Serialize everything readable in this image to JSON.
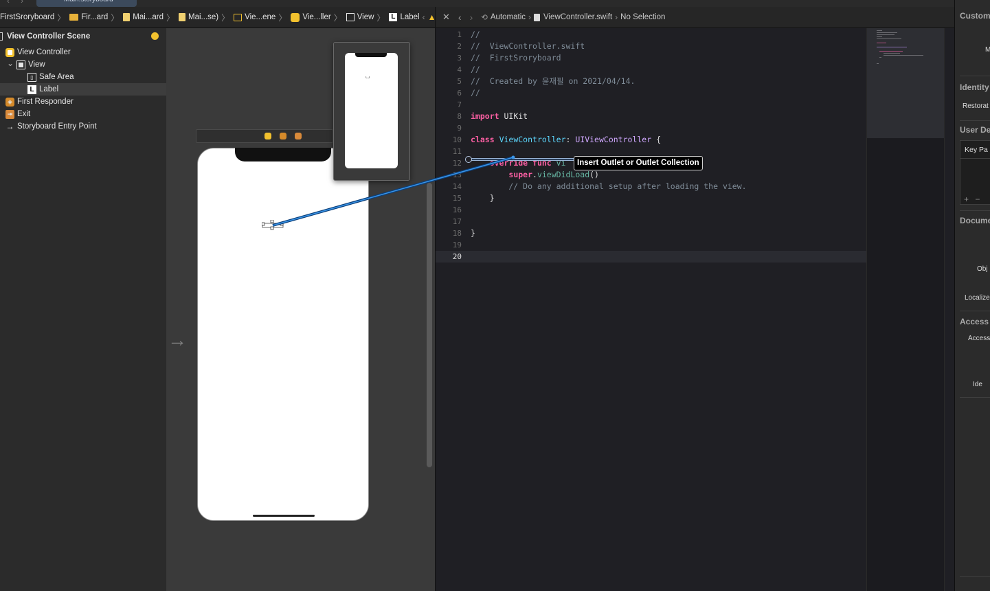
{
  "top": {
    "tab_title": "Main.storyboard"
  },
  "jumpbar_left": [
    {
      "label": "FirstSroryboard",
      "icon": "none"
    },
    {
      "label": "Fir...ard",
      "icon": "folder-icon"
    },
    {
      "label": "Mai...ard",
      "icon": "storyboard-file-icon"
    },
    {
      "label": "Mai...se)",
      "icon": "storyboard-file-icon"
    },
    {
      "label": "Vie...ene",
      "icon": "scene-icon"
    },
    {
      "label": "Vie...ller",
      "icon": "view-controller-icon"
    },
    {
      "label": "View",
      "icon": "view-icon"
    },
    {
      "label": "Label",
      "icon": "label-icon"
    }
  ],
  "jumpbar_right": {
    "mode": "Automatic",
    "file": "ViewController.swift",
    "selection": "No Selection"
  },
  "outline": {
    "scene": "View Controller Scene",
    "items": [
      {
        "label": "View Controller",
        "indent": 0,
        "icon": "view-controller-icon"
      },
      {
        "label": "View",
        "indent": 1,
        "icon": "view-icon",
        "disclosure": "v"
      },
      {
        "label": "Safe Area",
        "indent": 2,
        "icon": "safe-area-icon"
      },
      {
        "label": "Label",
        "indent": 2,
        "icon": "label-icon",
        "selected": true
      },
      {
        "label": "First Responder",
        "indent": 0,
        "icon": "first-responder-icon"
      },
      {
        "label": "Exit",
        "indent": 0,
        "icon": "exit-icon"
      },
      {
        "label": "Storyboard Entry Point",
        "indent": 0,
        "icon": "entry-point-icon"
      }
    ]
  },
  "canvas": {
    "label_text": "Label"
  },
  "code": {
    "lines": [
      {
        "n": "1",
        "tokens": [
          [
            "cm",
            "//"
          ]
        ]
      },
      {
        "n": "2",
        "tokens": [
          [
            "cm",
            "//  ViewController.swift"
          ]
        ]
      },
      {
        "n": "3",
        "tokens": [
          [
            "cm",
            "//  FirstSroryboard"
          ]
        ]
      },
      {
        "n": "4",
        "tokens": [
          [
            "cm",
            "//"
          ]
        ]
      },
      {
        "n": "5",
        "tokens": [
          [
            "cm",
            "//  Created by 윤재필 on 2021/04/14."
          ]
        ]
      },
      {
        "n": "6",
        "tokens": [
          [
            "cm",
            "//"
          ]
        ]
      },
      {
        "n": "7",
        "tokens": []
      },
      {
        "n": "8",
        "tokens": [
          [
            "kw",
            "import"
          ],
          [
            "pl",
            " UIKit"
          ]
        ]
      },
      {
        "n": "9",
        "tokens": []
      },
      {
        "n": "10",
        "tokens": [
          [
            "kw",
            "class"
          ],
          [
            "pl",
            " "
          ],
          [
            "nm",
            "ViewController"
          ],
          [
            "pl",
            ": "
          ],
          [
            "ty",
            "UIViewController"
          ],
          [
            "pl",
            " {"
          ]
        ]
      },
      {
        "n": "11",
        "tokens": []
      },
      {
        "n": "12",
        "tokens": [
          [
            "pl",
            "    "
          ],
          [
            "kw",
            "override"
          ],
          [
            "pl",
            " "
          ],
          [
            "kw",
            "func"
          ],
          [
            "pl",
            " "
          ],
          [
            "fn",
            "vi"
          ]
        ]
      },
      {
        "n": "13",
        "tokens": [
          [
            "pl",
            "        "
          ],
          [
            "kw",
            "super"
          ],
          [
            "pl",
            "."
          ],
          [
            "fn",
            "viewDidLoad"
          ],
          [
            "pl",
            "()"
          ]
        ]
      },
      {
        "n": "14",
        "tokens": [
          [
            "cm",
            "        // Do any additional setup after loading the view."
          ]
        ]
      },
      {
        "n": "15",
        "tokens": [
          [
            "pl",
            "    }"
          ]
        ]
      },
      {
        "n": "16",
        "tokens": []
      },
      {
        "n": "17",
        "tokens": []
      },
      {
        "n": "18",
        "tokens": [
          [
            "pl",
            "}"
          ]
        ]
      },
      {
        "n": "19",
        "tokens": []
      },
      {
        "n": "20",
        "tokens": [],
        "current": true
      }
    ],
    "tooltip": "Insert Outlet or Outlet Collection"
  },
  "inspector": {
    "custom_class": "Custom",
    "m": "M",
    "identity": "Identity",
    "restoration": "Restorat",
    "user_defined": "User De",
    "key_path": "Key Pa",
    "plus": "+",
    "minus": "−",
    "document": "Docume",
    "object": "Obj",
    "localize": "Localize",
    "accessibility": "Access",
    "access_sub": "Access",
    "identifier": "Ide"
  },
  "colors": {
    "accent_blue": "#1e78d2",
    "keyword": "#fc5fa3",
    "type": "#d0a8ff",
    "comment": "#7f8c98",
    "warning": "#f2c12e"
  }
}
